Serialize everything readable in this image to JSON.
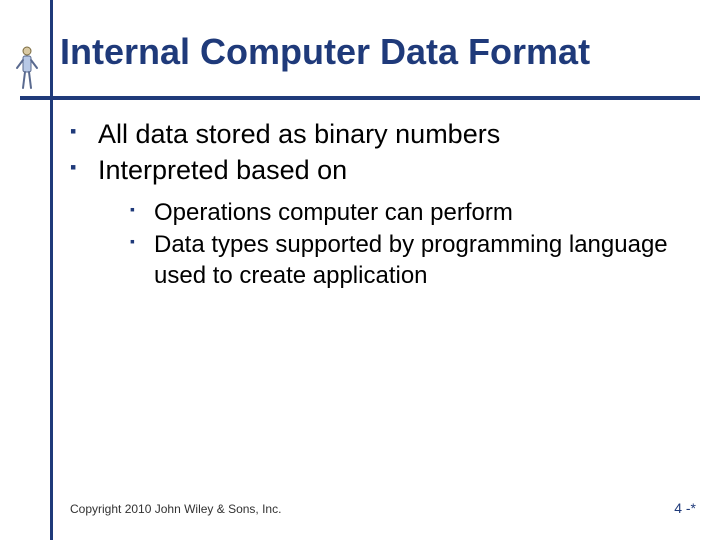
{
  "title": "Internal Computer Data Format",
  "bullets": {
    "level1": [
      "All data stored as binary numbers",
      "Interpreted based on"
    ],
    "level2": [
      "Operations computer can perform",
      "Data types supported by programming language used to create application"
    ]
  },
  "footer": {
    "copyright": "Copyright 2010 John Wiley & Sons, Inc.",
    "page": "4 -*"
  },
  "colors": {
    "accent": "#1f3a7a"
  }
}
